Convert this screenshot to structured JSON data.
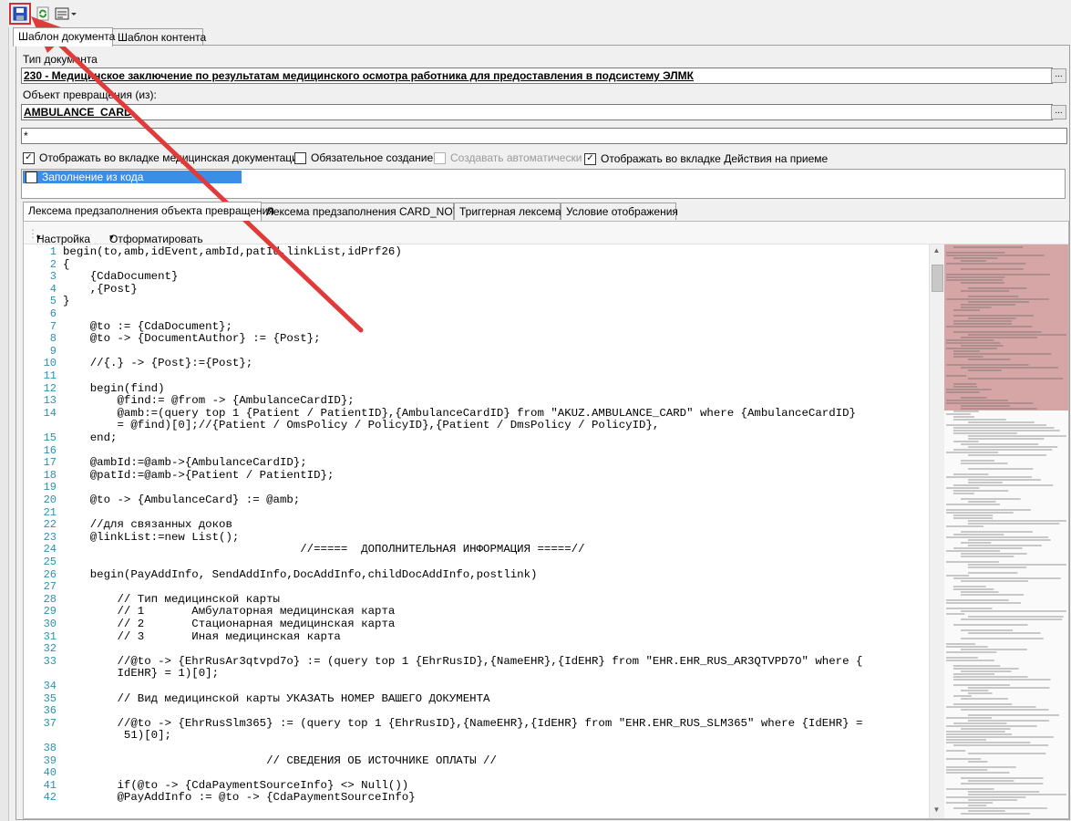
{
  "toolbar": {
    "buttons": [
      {
        "name": "save-icon"
      },
      {
        "name": "refresh-icon"
      },
      {
        "name": "layout-dropdown-icon"
      }
    ]
  },
  "top_tabs": [
    {
      "label": "Шаблон документа",
      "active": true
    },
    {
      "label": "Шаблон контента",
      "active": false
    }
  ],
  "form": {
    "doc_type_label": "Тип документа",
    "doc_type_value": "230 - Медицинское заключение по результатам медицинского осмотра работника для предоставления в подсистему ЭЛМК",
    "source_object_label": "Объект превращения (из):",
    "source_object_value": "AMBULANCE_CARD",
    "extra_field_value": "*",
    "dots_label": "...",
    "checkboxes": [
      {
        "label": "Отображать во вкладке медицинская документация",
        "checked": true,
        "disabled": false
      },
      {
        "label": "Обязательное создание",
        "checked": false,
        "disabled": false
      },
      {
        "label": "Создавать автоматически",
        "checked": false,
        "disabled": true
      },
      {
        "label": "Отображать во вкладке Действия на приеме",
        "checked": true,
        "disabled": false
      }
    ],
    "list_item": "Заполнение из кода"
  },
  "editor_tabs": [
    {
      "label": "Лексема предзаполнения объекта превращения",
      "active": true
    },
    {
      "label": "Лексема предзаполнения CARD_NOTE",
      "active": false
    },
    {
      "label": "Триггерная лексема",
      "active": false
    },
    {
      "label": "Условие отображения",
      "active": false
    }
  ],
  "editor_toolbar": {
    "settings_label": "Настройка",
    "format_label": "Отформатировать"
  },
  "code_lines": [
    {
      "n": "1",
      "text": "begin(to,amb,idEvent,ambId,patId,linkList,idPrf26)"
    },
    {
      "n": "2",
      "text": "{"
    },
    {
      "n": "3",
      "text": "    {CdaDocument}"
    },
    {
      "n": "4",
      "text": "    ,{Post}"
    },
    {
      "n": "5",
      "text": "}"
    },
    {
      "n": "6",
      "text": ""
    },
    {
      "n": "7",
      "text": "    @to := {CdaDocument};"
    },
    {
      "n": "8",
      "text": "    @to -> {DocumentAuthor} := {Post};"
    },
    {
      "n": "9",
      "text": ""
    },
    {
      "n": "10",
      "text": "    //{.} -> {Post}:={Post};"
    },
    {
      "n": "11",
      "text": ""
    },
    {
      "n": "12",
      "text": "    begin(find)"
    },
    {
      "n": "13",
      "text": "        @find:= @from -> {AmbulanceCardID};"
    },
    {
      "n": "14",
      "text": "        @amb:=(query top 1 {Patient / PatientID},{AmbulanceCardID} from \"AKUZ.AMBULANCE_CARD\" where {AmbulanceCardID}"
    },
    {
      "n": "",
      "text": "        = @find)[0];//{Patient / OmsPolicy / PolicyID},{Patient / DmsPolicy / PolicyID},"
    },
    {
      "n": "15",
      "text": "    end;"
    },
    {
      "n": "16",
      "text": ""
    },
    {
      "n": "17",
      "text": "    @ambId:=@amb->{AmbulanceCardID};"
    },
    {
      "n": "18",
      "text": "    @patId:=@amb->{Patient / PatientID};"
    },
    {
      "n": "19",
      "text": ""
    },
    {
      "n": "20",
      "text": "    @to -> {AmbulanceCard} := @amb;"
    },
    {
      "n": "21",
      "text": ""
    },
    {
      "n": "22",
      "text": "    //для связанных доков"
    },
    {
      "n": "23",
      "text": "    @linkList:=new List();"
    },
    {
      "n": "24",
      "text": "                                   //=====  ДОПОЛНИТЕЛЬНАЯ ИНФОРМАЦИЯ =====//"
    },
    {
      "n": "25",
      "text": ""
    },
    {
      "n": "26",
      "text": "    begin(PayAddInfo, SendAddInfo,DocAddInfo,childDocAddInfo,postlink)"
    },
    {
      "n": "27",
      "text": ""
    },
    {
      "n": "28",
      "text": "        // Тип медицинской карты"
    },
    {
      "n": "29",
      "text": "        // 1       Амбулаторная медицинская карта"
    },
    {
      "n": "30",
      "text": "        // 2       Стационарная медицинская карта"
    },
    {
      "n": "31",
      "text": "        // 3       Иная медицинская карта"
    },
    {
      "n": "32",
      "text": ""
    },
    {
      "n": "33",
      "text": "        //@to -> {EhrRusAr3qtvpd7o} := (query top 1 {EhrRusID},{NameEHR},{IdEHR} from \"EHR.EHR_RUS_AR3QTVPD7O\" where {"
    },
    {
      "n": "",
      "text": "        IdEHR} = 1)[0];"
    },
    {
      "n": "34",
      "text": ""
    },
    {
      "n": "35",
      "text": "        // Вид медицинской карты УКАЗАТЬ НОМЕР ВАШЕГО ДОКУМЕНТА"
    },
    {
      "n": "36",
      "text": ""
    },
    {
      "n": "37",
      "text": "        //@to -> {EhrRusSlm365} := (query top 1 {EhrRusID},{NameEHR},{IdEHR} from \"EHR.EHR_RUS_SLM365\" where {IdEHR} ="
    },
    {
      "n": "",
      "text": "         51)[0];"
    },
    {
      "n": "38",
      "text": ""
    },
    {
      "n": "39",
      "text": "                              // СВЕДЕНИЯ ОБ ИСТОЧНИКЕ ОПЛАТЫ //"
    },
    {
      "n": "40",
      "text": ""
    },
    {
      "n": "41",
      "text": "        if(@to -> {CdaPaymentSourceInfo} <> Null())"
    },
    {
      "n": "42",
      "text": "        @PayAddInfo := @to -> {CdaPaymentSourceInfo}"
    }
  ],
  "colors": {
    "selection": "#3a8ee6",
    "annotation_arrow": "#e03a3a",
    "line_numbers": "#2b91af",
    "minimap_highlight": "#c98a8a"
  }
}
